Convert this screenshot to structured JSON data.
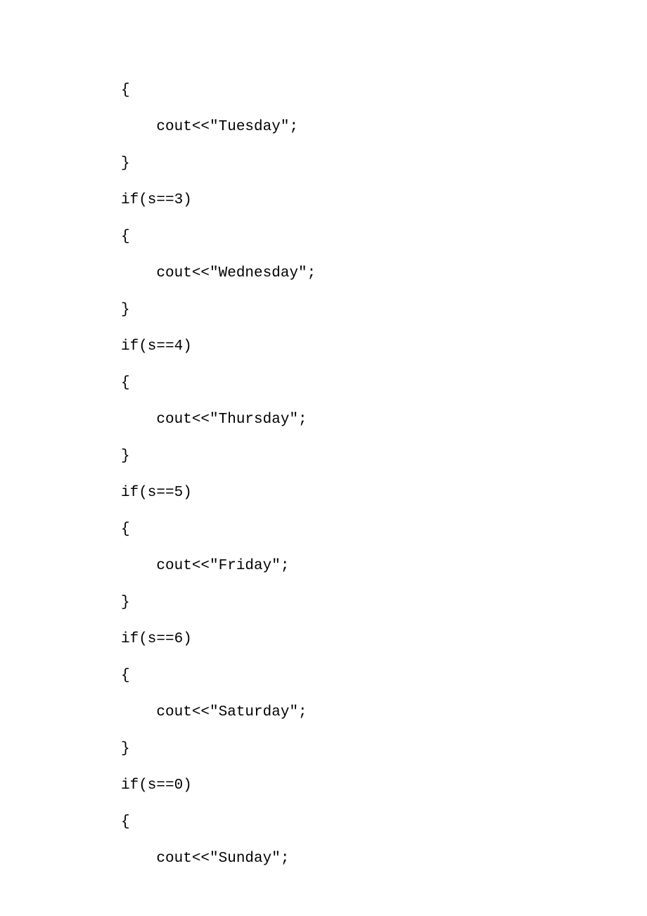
{
  "lines": [
    "{",
    "    cout<<\"Tuesday\";",
    "}",
    "if(s==3)",
    "{",
    "    cout<<\"Wednesday\";",
    "}",
    "if(s==4)",
    "{",
    "    cout<<\"Thursday\";",
    "}",
    "if(s==5)",
    "{",
    "    cout<<\"Friday\";",
    "}",
    "if(s==6)",
    "{",
    "    cout<<\"Saturday\";",
    "}",
    "if(s==0)",
    "{",
    "    cout<<\"Sunday\";"
  ]
}
